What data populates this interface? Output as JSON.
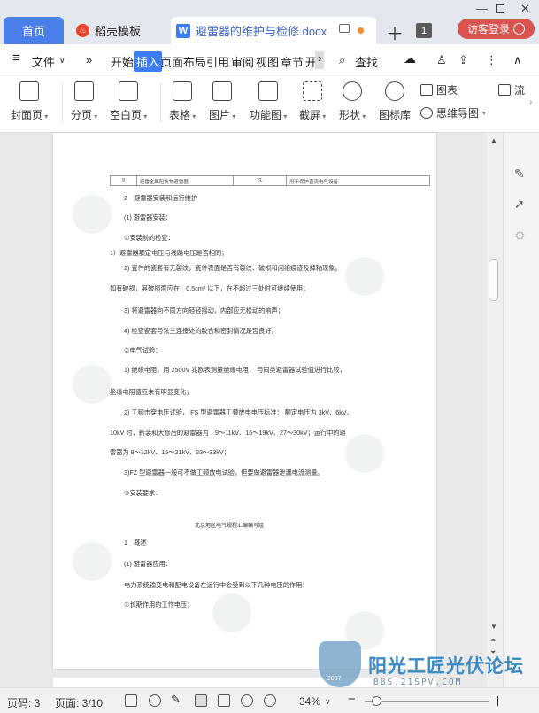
{
  "tabs": {
    "home": "首页",
    "template": "稻壳模板",
    "document": "避雷器的维护与检修.docx",
    "count": "1",
    "login": "访客登录"
  },
  "menu": {
    "file": "文件",
    "items": [
      "开始",
      "插入",
      "页面布局",
      "引用",
      "审阅",
      "视图",
      "章节",
      "开"
    ],
    "search": "查找"
  },
  "ribbon": {
    "cover": "封面页",
    "pagebreak": "分页",
    "blankpage": "空白页",
    "table": "表格",
    "picture": "图片",
    "funcgraph": "功能图",
    "screenshot": "截屏",
    "shape": "形状",
    "iconlib": "图标库",
    "chart": "图表",
    "mindmap": "思维导图",
    "flow": "流"
  },
  "document": {
    "table_cells": [
      "9",
      "避雷金属阻抗物避雷器",
      "YL",
      "用于保护直流电气设备"
    ],
    "lines": [
      "2　避雷器安装和运行维护",
      "(1) 避雷器安装：",
      "①安装前的检查：",
      "1）避雷器额定电压与线路电压是否相同；",
      "2) 瓷件的瓷套有无裂纹，瓷件表面是否有裂纹、破损和闪络痕迹及掉釉现象。",
      "如有破损，其破损面应在　0.5cm² 以下，在不超过三处时可继续使用；",
      "3) 将避雷器向不同方向轻轻摇动，内部应无松动的响声；",
      "4) 检查瓷套与法兰连接处的胶合和密封情况是否良好。",
      "②电气试验：",
      "1) 绝缘电阻，用 2500V 兆欧表测量绝缘电阻， 与同类避雷器试验值进行比较，",
      "绝缘电阻值应未有明显变化；",
      "2) 工频击穿电压试验， FS 型避雷器工频放电电压标准： 额定电压为 3kV、6kV、",
      "10kV 时，新装和大修后的避雷器为　9～11kV、16～19kV、27～30kV；运行中的避",
      "雷器为 8～12kV、15～21kV、23～33kV；",
      "3)FZ 型避雷器一般可不做工频放电试验，但要做避雷器泄漏电流测量。",
      "③安装要求：",
      "北京地区电气规程汇编编写组",
      "1　概述",
      "(1) 避雷器应用：",
      "电力系统输变电和配电设备在运行中会受到以下几种电压的作用：",
      "①长期作用的工作电压；"
    ]
  },
  "status": {
    "pagecode": "页码: 3",
    "page": "页面: 3/10",
    "zoom": "34%"
  },
  "watermark": {
    "name": "阳光工匠光伏论坛",
    "url": "BBS.21SPV.COM",
    "year": "2007"
  }
}
